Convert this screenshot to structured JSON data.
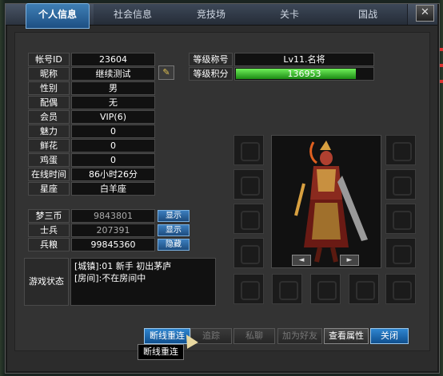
{
  "tabs": [
    {
      "label": "个人信息",
      "active": true
    },
    {
      "label": "社会信息",
      "active": false
    },
    {
      "label": "竞技场",
      "active": false
    },
    {
      "label": "关卡",
      "active": false
    },
    {
      "label": "国战",
      "active": false
    }
  ],
  "close_label": "✕",
  "profile": {
    "account_id_label": "帐号ID",
    "account_id": "23604",
    "nickname_label": "昵称",
    "nickname": "继续测试",
    "gender_label": "性别",
    "gender": "男",
    "spouse_label": "配偶",
    "spouse": "无",
    "member_label": "会员",
    "member": "VIP(6)",
    "charm_label": "魅力",
    "charm": "0",
    "flowers_label": "鲜花",
    "flowers": "0",
    "eggs_label": "鸡蛋",
    "eggs": "0",
    "online_label": "在线时间",
    "online": "86小时26分",
    "zodiac_label": "星座",
    "zodiac": "白羊座"
  },
  "rank": {
    "title_label": "等级称号",
    "title": "Lv11.名将",
    "points_label": "等级积分",
    "points": "136953",
    "points_progress": 0.88
  },
  "currency": {
    "dream_coins_label": "梦三币",
    "dream_coins": "9843801",
    "dream_coins_btn": "显示",
    "soldiers_label": "士兵",
    "soldiers": "207391",
    "soldiers_btn": "显示",
    "grain_label": "兵粮",
    "grain": "99845360",
    "grain_btn": "隐藏"
  },
  "game_status": {
    "label": "游戏状态",
    "lines": [
      "[城镇]:01 新手 初出茅庐",
      "[房间]:不在房间中"
    ]
  },
  "buttons": {
    "reconnect": "断线重连",
    "track": "追踪",
    "chat": "私聊",
    "add_friend": "加为好友",
    "view_attr": "查看属性",
    "close": "关闭"
  },
  "tooltip": "断线重连",
  "portrait_arrows": {
    "left": "◄",
    "right": "►"
  },
  "colors": {
    "accent": "#2f86d0",
    "xp": "#3fd22a"
  }
}
